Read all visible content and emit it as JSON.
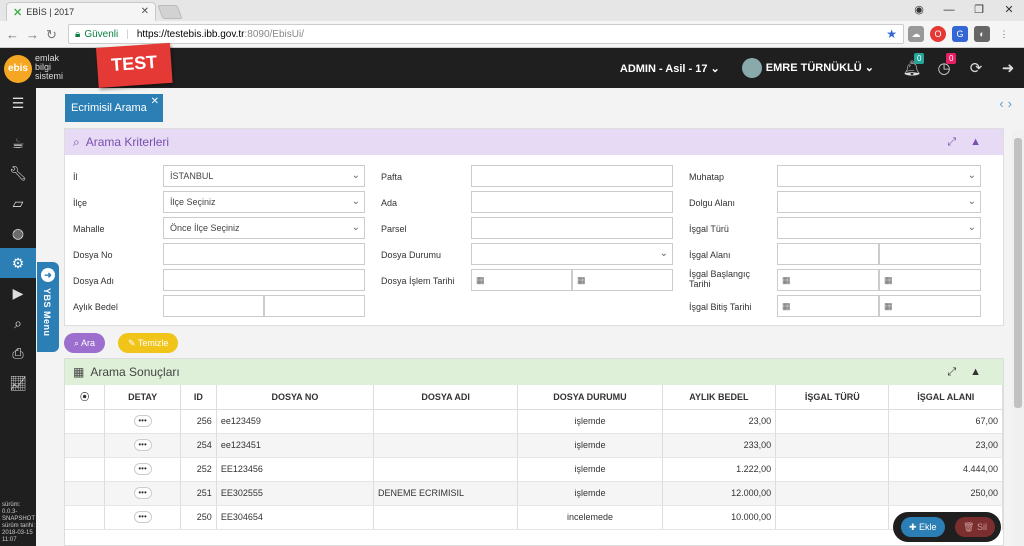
{
  "browser": {
    "tab_title": "EBİS | 2017",
    "secure_label": "Güvenli",
    "url_host": "https://testebis.ibb.gov.tr",
    "url_path": ":8090/EbisUi/"
  },
  "header": {
    "logo": "ebis",
    "logo_text": [
      "emlak",
      "bilgi",
      "sistemi"
    ],
    "badge": "TEST",
    "role": "ADMIN - Asil - 17",
    "user": "EMRE TÜRNÜKLÜ",
    "notif1": "0",
    "notif2": "0"
  },
  "sidebar": {
    "ybs_label": "YBS Menu",
    "footer": [
      "sürüm:",
      "0.0.3-",
      "SNAPSHOT",
      "sürüm tarihi:",
      "2018-03-15",
      "11:07"
    ]
  },
  "page_tab": "Ecrimisil Arama",
  "criteria": {
    "title": "Arama Kriterleri",
    "col1": [
      {
        "label": "İl",
        "value": "İSTANBUL"
      },
      {
        "label": "İlçe",
        "value": "İlçe Seçiniz"
      },
      {
        "label": "Mahalle",
        "value": "Önce İlçe Seçiniz"
      },
      {
        "label": "Dosya No",
        "value": ""
      },
      {
        "label": "Dosya Adı",
        "value": ""
      },
      {
        "label": "Aylık Bedel",
        "value": ""
      }
    ],
    "col2": [
      {
        "label": "Pafta"
      },
      {
        "label": "Ada"
      },
      {
        "label": "Parsel"
      },
      {
        "label": "Dosya Durumu"
      },
      {
        "label": "Dosya İşlem Tarihi"
      }
    ],
    "col3": [
      {
        "label": "Muhatap"
      },
      {
        "label": "Dolgu Alanı"
      },
      {
        "label": "İşgal Türü"
      },
      {
        "label": "İşgal Alanı"
      },
      {
        "label": "İşgal Başlangıç Tarihi"
      },
      {
        "label": "İşgal Bitiş Tarihi"
      }
    ],
    "search_button": "Ara",
    "clear_button": "Temizle"
  },
  "results": {
    "title": "Arama Sonuçları",
    "columns": [
      "DETAY",
      "ID",
      "DOSYA NO",
      "DOSYA ADI",
      "DOSYA DURUMU",
      "AYLIK BEDEL",
      "İŞGAL TÜRÜ",
      "İŞGAL ALANI"
    ],
    "rows": [
      {
        "id": "256",
        "no": "ee123459",
        "adi": "",
        "durum": "işlemde",
        "bedel": "23,00",
        "tur": "",
        "alan": "67,00"
      },
      {
        "id": "254",
        "no": "ee123451",
        "adi": "",
        "durum": "işlemde",
        "bedel": "233,00",
        "tur": "",
        "alan": "23,00"
      },
      {
        "id": "252",
        "no": "EE123456",
        "adi": "",
        "durum": "işlemde",
        "bedel": "1.222,00",
        "tur": "",
        "alan": "4.444,00"
      },
      {
        "id": "251",
        "no": "EE302555",
        "adi": "DENEME ECRIMISIL",
        "durum": "işlemde",
        "bedel": "12.000,00",
        "tur": "",
        "alan": "250,00"
      },
      {
        "id": "250",
        "no": "EE304654",
        "adi": "",
        "durum": "incelemede",
        "bedel": "10.000,00",
        "tur": "",
        "alan": ""
      }
    ]
  },
  "fab": {
    "add": "Ekle",
    "delete": "Sil"
  }
}
